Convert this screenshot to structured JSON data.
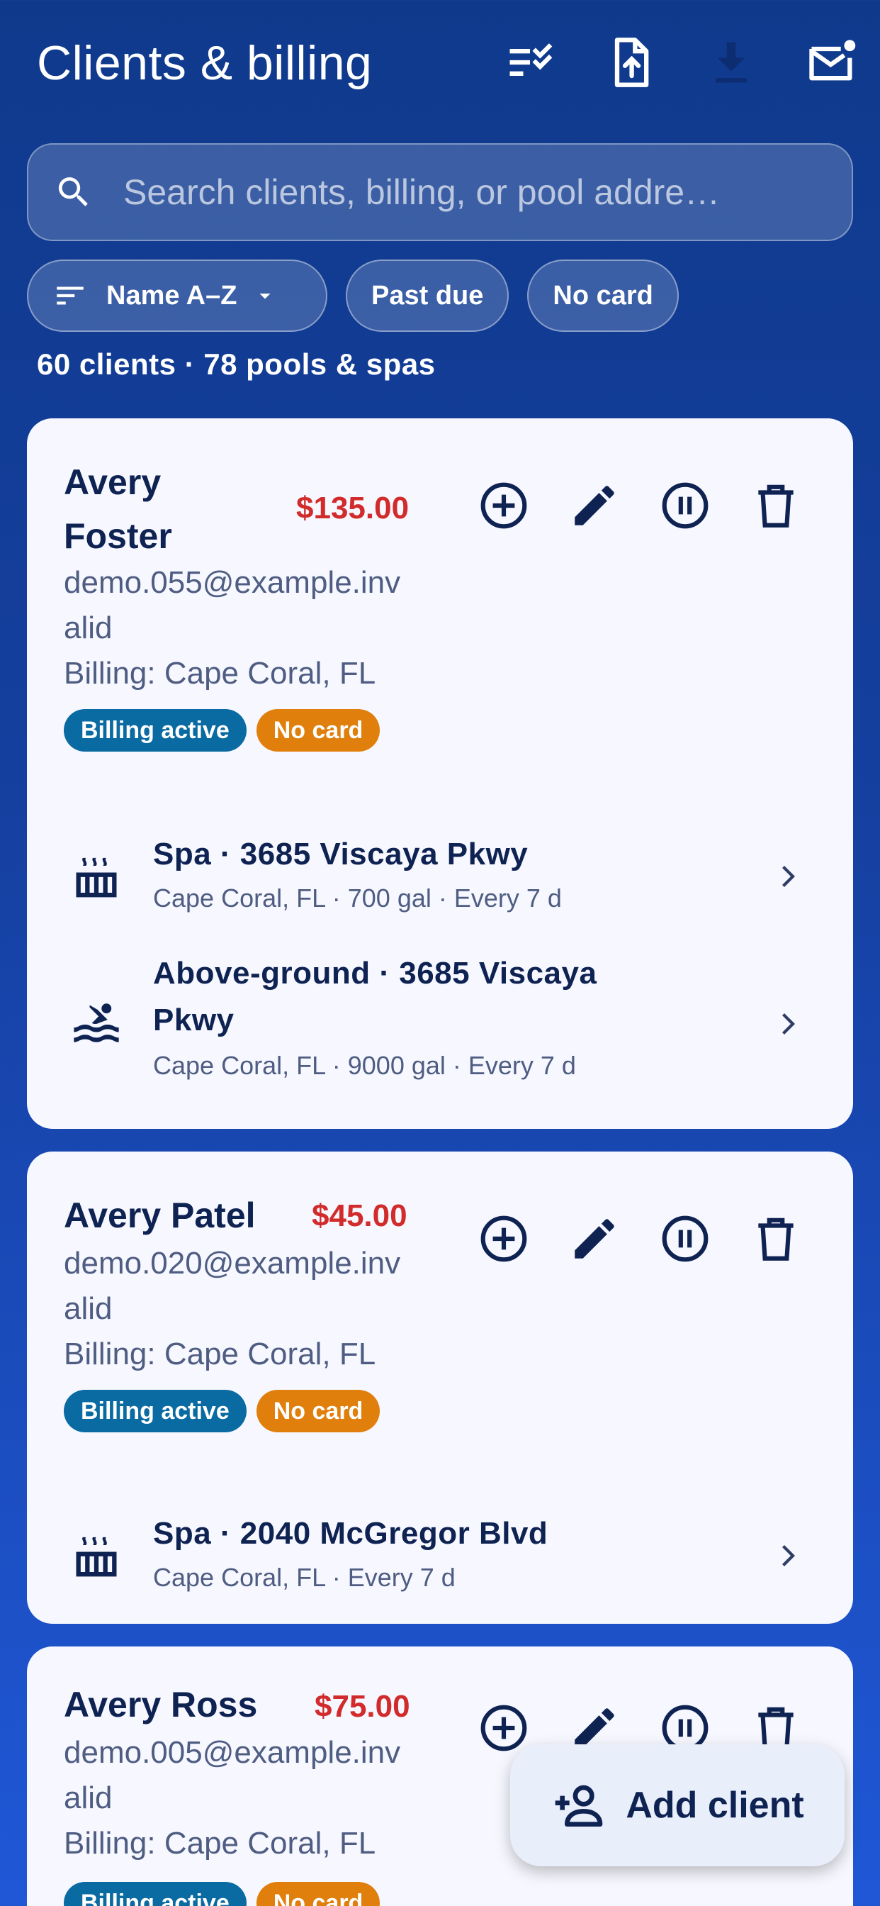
{
  "header": {
    "title": "Clients & billing",
    "actions": [
      "checklist-icon",
      "upload-file-icon",
      "download-icon",
      "mail-notification-icon"
    ]
  },
  "search": {
    "placeholder": "Search clients, billing, or pool addre…"
  },
  "filters": {
    "sort_label": "Name A–Z",
    "chips": [
      "Past due",
      "No card"
    ]
  },
  "summary": "60 clients · 78 pools & spas",
  "clients": [
    {
      "name_line1": "Avery",
      "name_line2": "Foster",
      "amount": "$135.00",
      "email_line1": "demo.055@example.inv",
      "email_line2": "alid",
      "billing": "Billing: Cape Coral, FL",
      "badges": [
        "Billing active",
        "No card"
      ],
      "pools": [
        {
          "title": "Spa · 3685 Viscaya Pkwy",
          "subtitle": "Cape Coral, FL · 700 gal · Every 7 d",
          "icon": "hot-tub-icon"
        },
        {
          "title_line1": "Above-ground · 3685 Viscaya",
          "title_line2": "Pkwy",
          "subtitle": "Cape Coral, FL · 9000 gal · Every 7 d",
          "icon": "pool-icon"
        }
      ]
    },
    {
      "name": "Avery Patel",
      "amount": "$45.00",
      "email_line1": "demo.020@example.inv",
      "email_line2": "alid",
      "billing": "Billing: Cape Coral, FL",
      "badges": [
        "Billing active",
        "No card"
      ],
      "pools": [
        {
          "title": "Spa · 2040 McGregor Blvd",
          "subtitle": "Cape Coral, FL · Every 7 d",
          "icon": "hot-tub-icon"
        }
      ]
    },
    {
      "name": "Avery Ross",
      "amount": "$75.00",
      "email_line1": "demo.005@example.inv",
      "email_line2": "alid",
      "billing": "Billing: Cape Coral, FL",
      "badges": [
        "Billing active",
        "No card"
      ]
    }
  ],
  "fab": {
    "label": "Add client"
  },
  "colors": {
    "background": "#153f9e",
    "card": "#f7f8ff",
    "text_primary": "#0f2353",
    "amount": "#d12b2b",
    "badge_active": "#0a6aa2",
    "badge_nocard": "#e07f0c"
  }
}
